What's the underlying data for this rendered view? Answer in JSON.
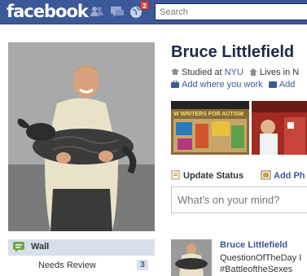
{
  "header": {
    "logo_text": "facebook",
    "notification_count": "2",
    "search_placeholder": "Search"
  },
  "sidebar": {
    "wall_label": "Wall",
    "needs_review_label": "Needs Review",
    "needs_review_count": "3"
  },
  "profile": {
    "name": "Bruce Littlefield",
    "studied_prefix": "Studied at",
    "school": "NYU",
    "lives_text": "Lives in N",
    "add_work": "Add where you work",
    "add_other": "Add"
  },
  "photos": {
    "photo1_caption": "W WRITERS FOR AUTISM"
  },
  "composer": {
    "update_status_label": "Update Status",
    "add_photo_label": "Add Ph",
    "status_placeholder": "What's on your mind?"
  },
  "feed": {
    "story_author": "Bruce Littlefield",
    "story_line1": "QuestionOfTheDay I",
    "story_line2": "#BattleoftheSexes"
  },
  "colors": {
    "brand_blue": "#3b5998",
    "nav_highlight": "#d8dfea",
    "link_blue": "#3b5998",
    "name_color": "#1c2a47"
  }
}
